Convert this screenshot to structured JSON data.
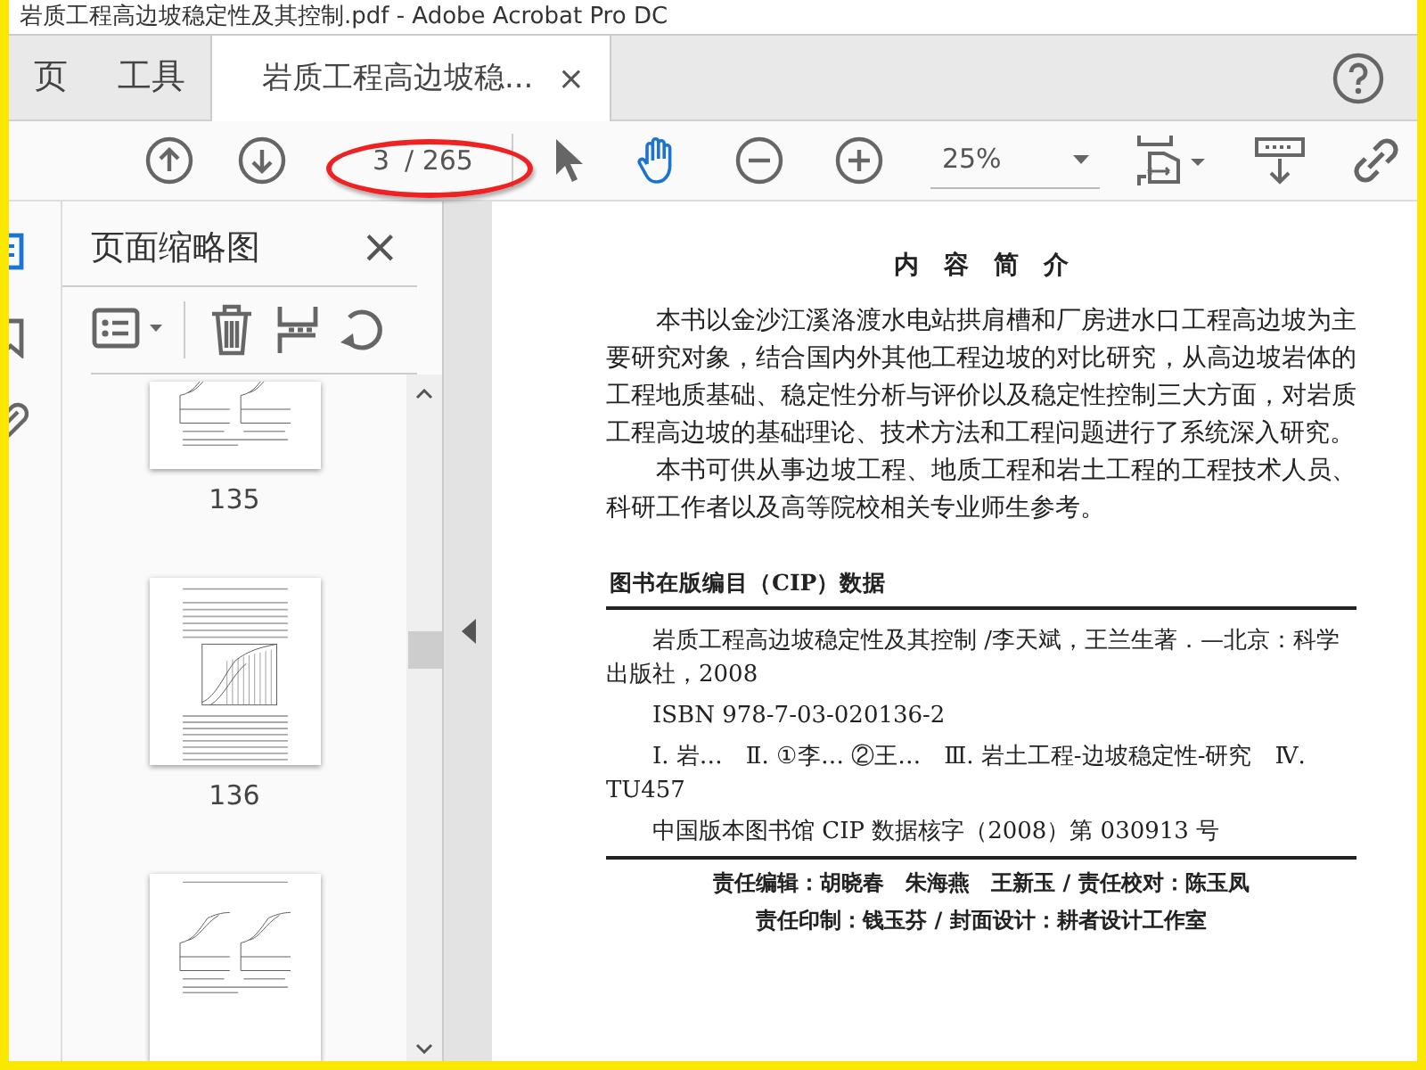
{
  "window": {
    "title": "岩质工程高边坡稳定性及其控制.pdf - Adobe Acrobat Pro DC"
  },
  "tabs": [
    {
      "label": "页",
      "selected": false
    },
    {
      "label": "工具",
      "selected": false
    },
    {
      "label": "岩质工程高边坡稳...",
      "selected": true,
      "close": "×"
    }
  ],
  "toolbar": {
    "page_current": "3",
    "page_total": "/ 265",
    "zoom": "25%",
    "highlight": {
      "kind": "ellipse"
    },
    "tools": [
      {
        "kind": "select",
        "selected": false
      },
      {
        "kind": "hand",
        "selected": true
      }
    ]
  },
  "sidebar": {
    "rail": [
      {
        "kind": "thumbnails",
        "selected": true
      },
      {
        "kind": "bookmarks",
        "selected": false
      },
      {
        "kind": "attachments",
        "selected": false
      }
    ],
    "title": "页面缩略图",
    "close": "×",
    "thumbnails": [
      {
        "kind": "figures",
        "label": "135",
        "cut": true
      },
      {
        "kind": "chart",
        "label": "136",
        "cut": false
      },
      {
        "kind": "figures",
        "cut": false
      }
    ]
  },
  "document": {
    "heading": "内容简介",
    "paragraphs": [
      "本书以金沙江溪洛渡水电站拱肩槽和厂房进水口工程高边坡为主要研究对象，结合国内外其他工程边坡的对比研究，从高边坡岩体的工程地质基础、稳定性分析与评价以及稳定性控制三大方面，对岩质工程高边坡的基础理论、技术方法和工程问题进行了系统深入研究。",
      "本书可供从事边坡工程、地质工程和岩土工程的工程技术人员、科研工作者以及高等院校相关专业师生参考。"
    ],
    "cip_heading": "图书在版编目（CIP）数据",
    "cip_lines": [
      "岩质工程高边坡稳定性及其控制 /李天斌，王兰生著．—北京：科学出版社，2008",
      "ISBN 978-7-03-020136-2",
      "Ⅰ. 岩…　Ⅱ. ①李… ②王…　Ⅲ. 岩土工程-边坡稳定性-研究　Ⅳ. TU457",
      "中国版本图书馆 CIP 数据核字（2008）第 030913 号"
    ],
    "credits": [
      "责任编辑：胡晓春　朱海燕　王新玉 / 责任校对：陈玉凤",
      "责任印制：钱玉芬 / 封面设计：耕者设计工作室"
    ]
  }
}
